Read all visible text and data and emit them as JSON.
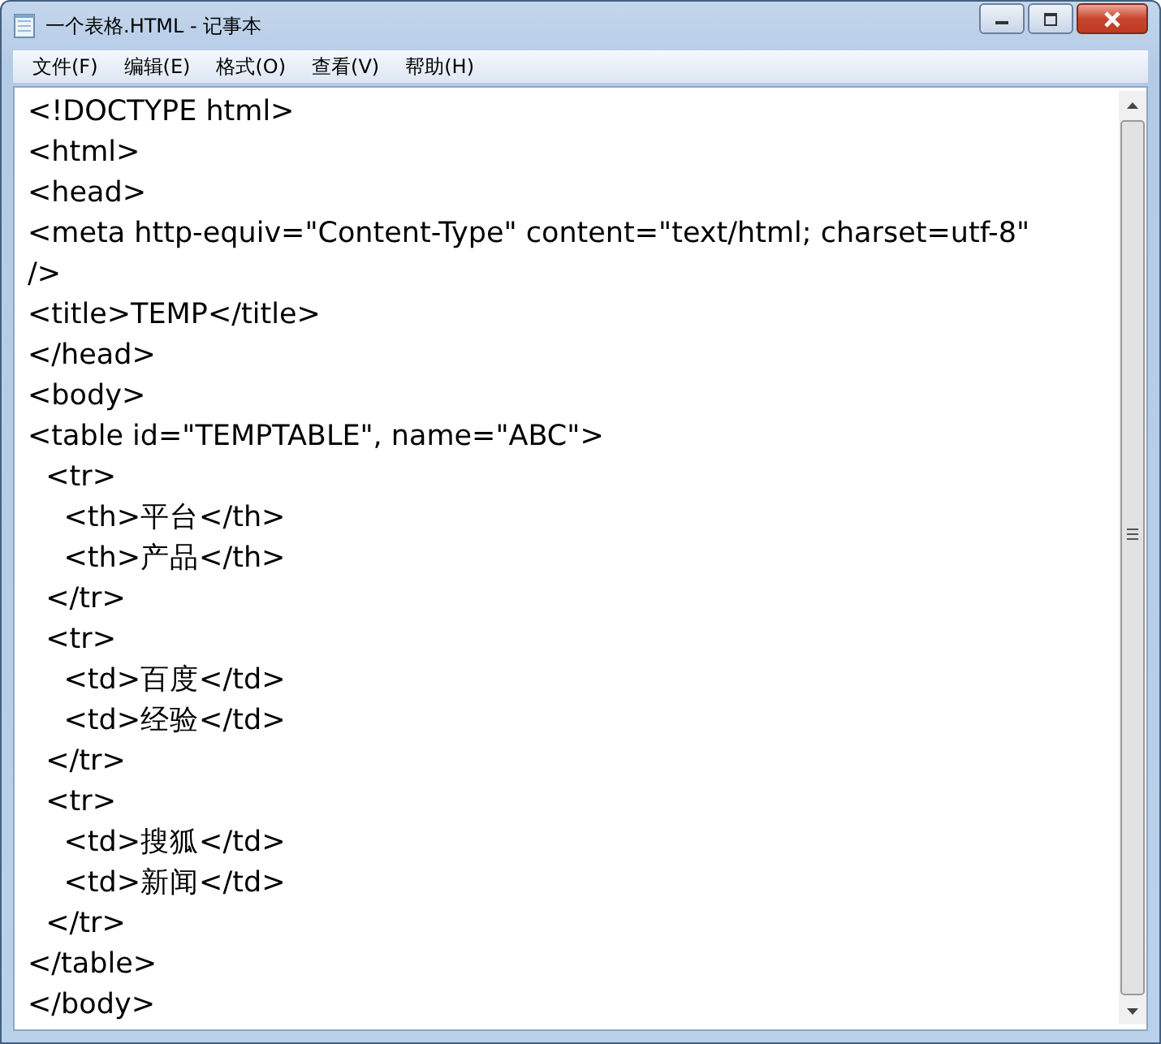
{
  "window": {
    "title": "一个表格.HTML - 记事本"
  },
  "menu": [
    "文件(F)",
    "编辑(E)",
    "格式(O)",
    "查看(V)",
    "帮助(H)"
  ],
  "lines": [
    "<!DOCTYPE html>",
    "<html>",
    "<head>",
    "<meta http-equiv=\"Content-Type\" content=\"text/html; charset=utf-8\"",
    "/>",
    "<title>TEMP</title>",
    "</head>",
    "<body>",
    "<table id=\"TEMPTABLE\", name=\"ABC\">",
    "  <tr>",
    "    <th>平台</th>",
    "    <th>产品</th>",
    "  </tr>",
    "  <tr>",
    "    <td>百度</td>",
    "    <td>经验</td>",
    "  </tr>",
    "  <tr>",
    "    <td>搜狐</td>",
    "    <td>新闻</td>",
    "  </tr>",
    "</table>",
    "</body>"
  ]
}
